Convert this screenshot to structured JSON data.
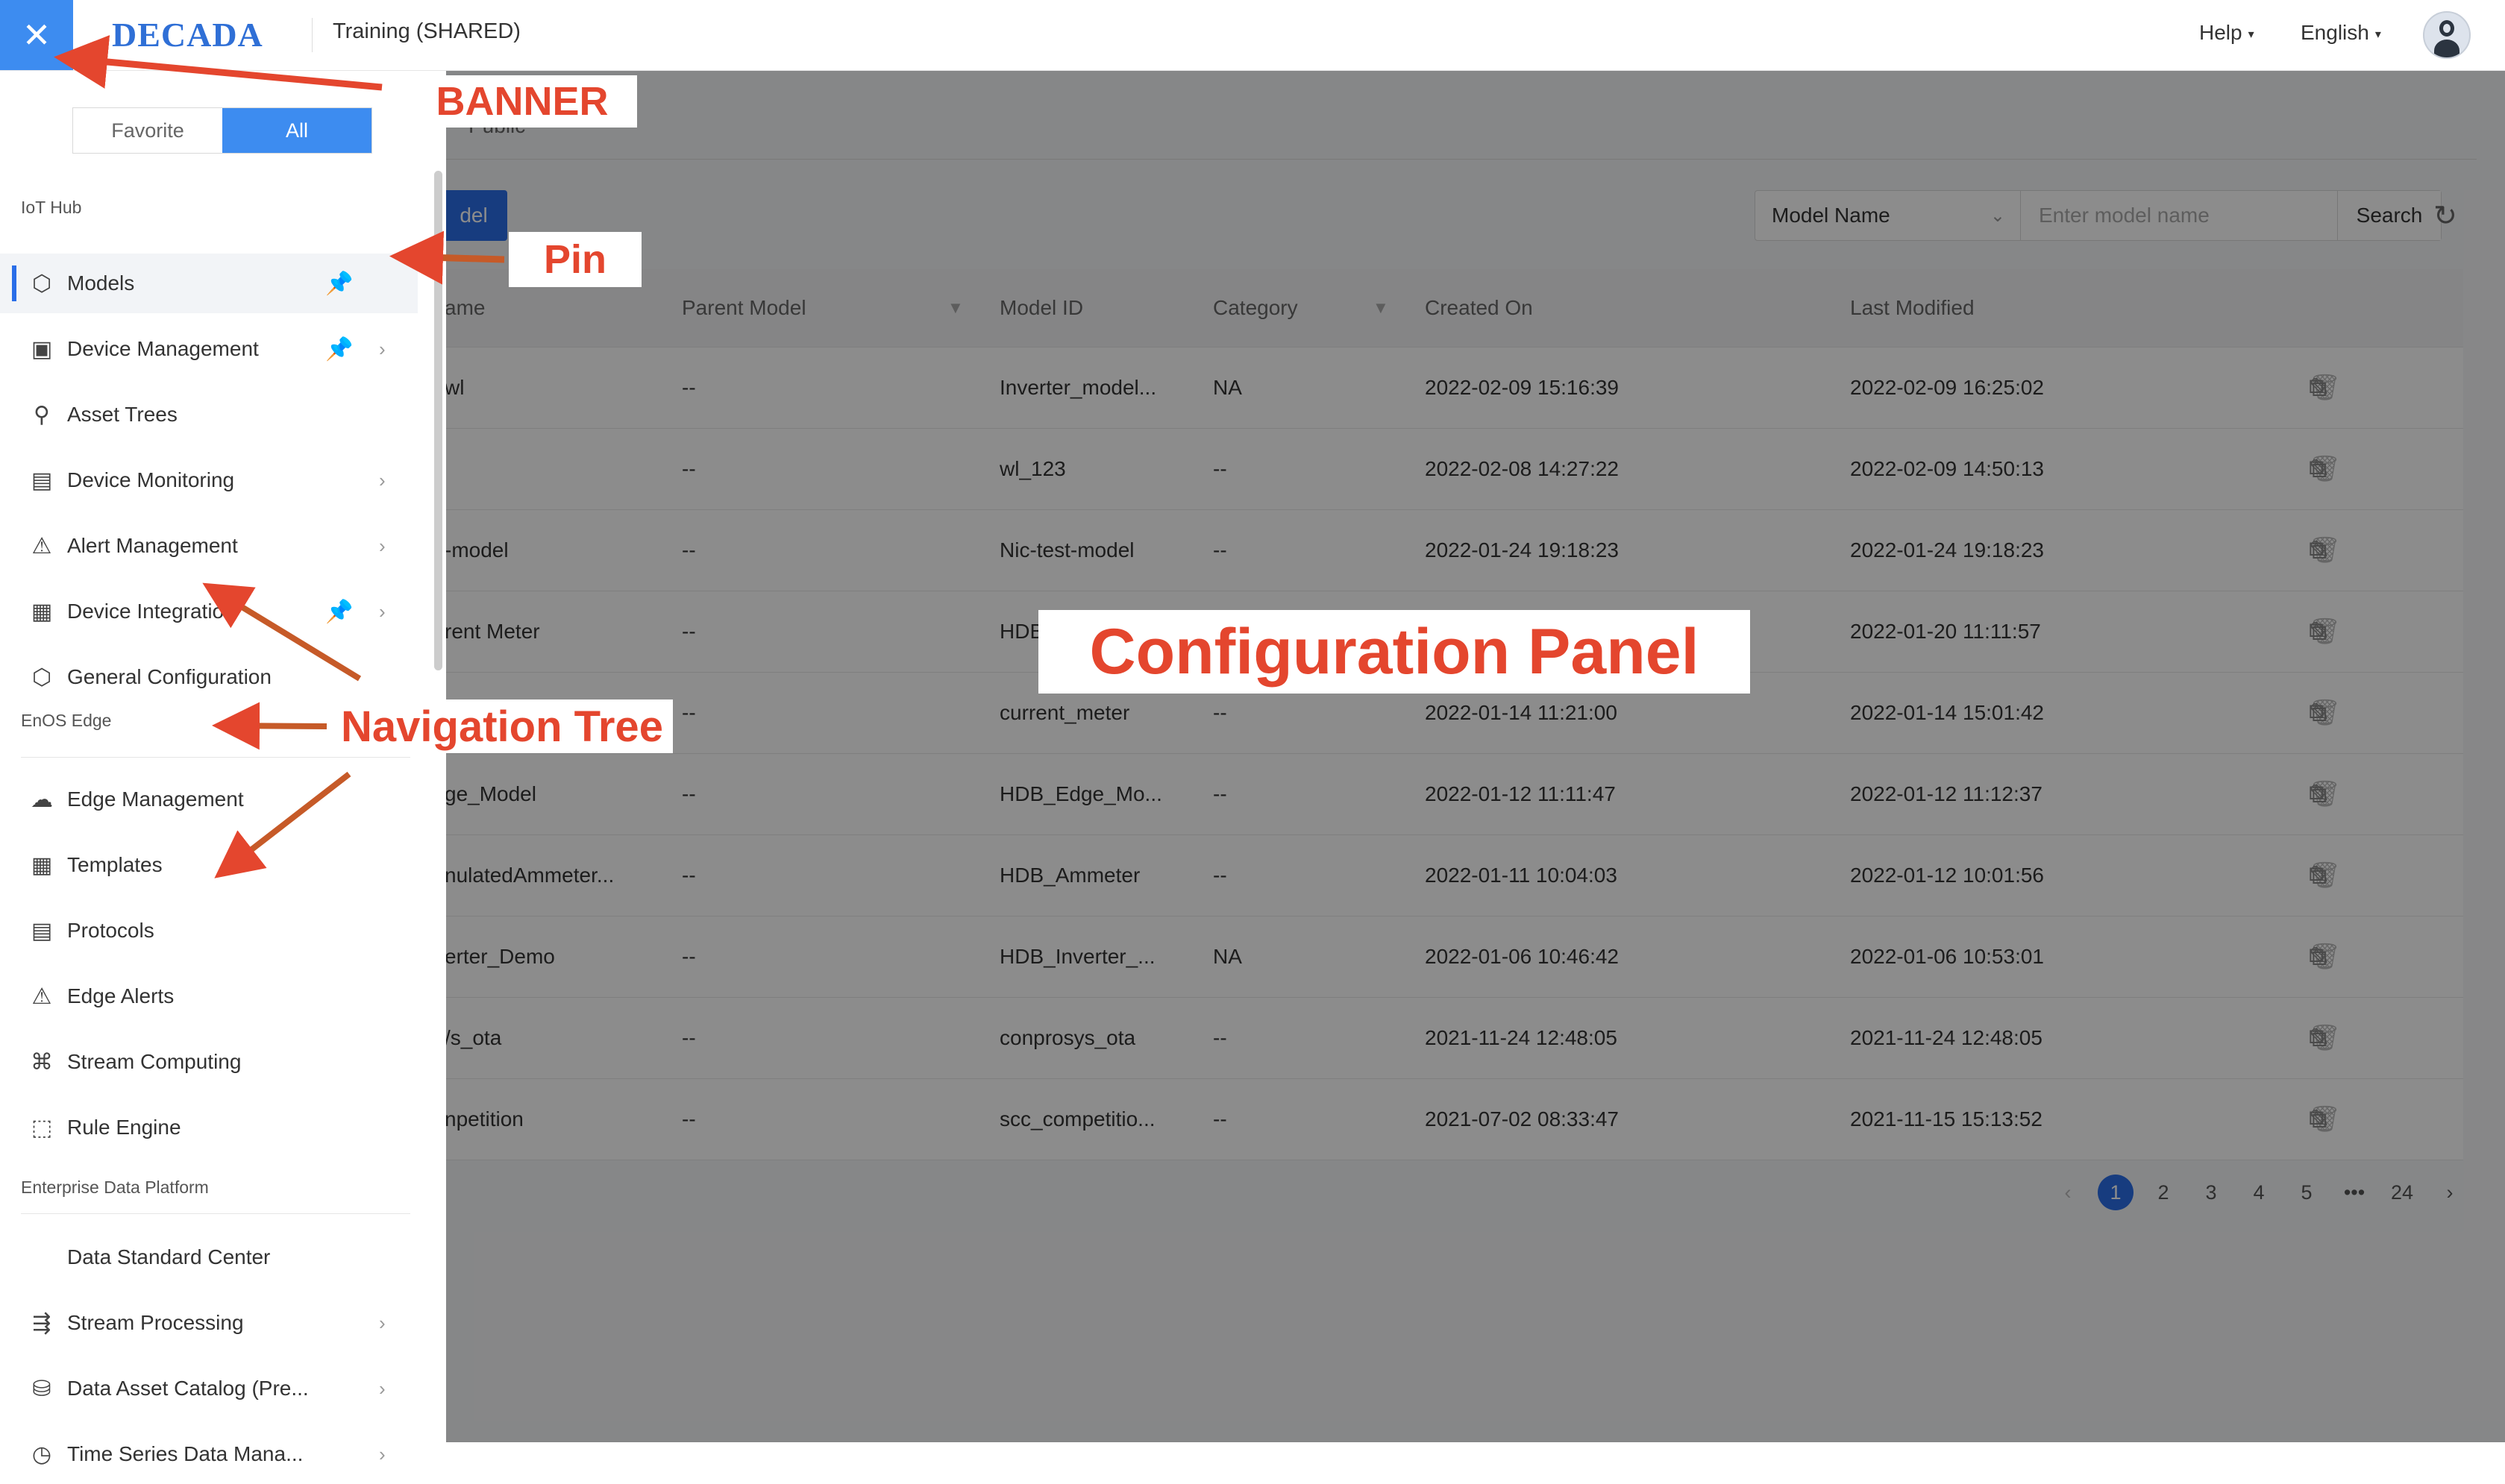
{
  "topbar": {
    "logo": "DECADA",
    "app_title": "Training (SHARED)",
    "help_label": "Help",
    "language_label": "English",
    "close_icon": "close-icon",
    "avatar_icon": "user-avatar-icon"
  },
  "sidebar": {
    "segment": {
      "favorite": "Favorite",
      "all": "All",
      "selected": "All"
    },
    "groups": [
      {
        "label": "IoT Hub",
        "items": [
          {
            "label": "Models",
            "icon": "cube-icon",
            "pinned": true,
            "chevron": false,
            "active": true
          },
          {
            "label": "Device Management",
            "icon": "device-icon",
            "pinned": true,
            "chevron": true
          },
          {
            "label": "Asset Trees",
            "icon": "tree-icon",
            "pinned": false,
            "chevron": false
          },
          {
            "label": "Device Monitoring",
            "icon": "monitor-icon",
            "pinned": false,
            "chevron": true
          },
          {
            "label": "Alert Management",
            "icon": "alert-icon",
            "pinned": false,
            "chevron": true
          },
          {
            "label": "Device Integration",
            "icon": "integration-icon",
            "pinned": true,
            "chevron": true
          },
          {
            "label": "General Configuration",
            "icon": "settings-icon",
            "pinned": false,
            "chevron": false
          }
        ]
      },
      {
        "label": "EnOS Edge",
        "items": [
          {
            "label": "Edge Management",
            "icon": "edge-icon",
            "pinned": false,
            "chevron": false
          },
          {
            "label": "Templates",
            "icon": "templates-icon",
            "pinned": false,
            "chevron": false
          },
          {
            "label": "Protocols",
            "icon": "protocols-icon",
            "pinned": false,
            "chevron": false
          },
          {
            "label": "Edge Alerts",
            "icon": "alert-icon",
            "pinned": false,
            "chevron": false
          },
          {
            "label": "Stream Computing",
            "icon": "stream-icon",
            "pinned": false,
            "chevron": false
          },
          {
            "label": "Rule Engine",
            "icon": "rule-icon",
            "pinned": false,
            "chevron": false
          }
        ]
      },
      {
        "label": "Enterprise Data Platform",
        "items": [
          {
            "label": "Data Standard Center",
            "icon": "",
            "pinned": false,
            "chevron": false
          },
          {
            "label": "Stream Processing",
            "icon": "stream-processing-icon",
            "pinned": false,
            "chevron": true
          },
          {
            "label": "Data Asset Catalog (Pre...",
            "icon": "catalog-icon",
            "pinned": false,
            "chevron": true
          },
          {
            "label": "Time Series Data Mana...",
            "icon": "timeseries-icon",
            "pinned": false,
            "chevron": true
          }
        ]
      }
    ]
  },
  "main": {
    "tab_public": "Public",
    "new_model_button": "del",
    "search": {
      "field_select": "Model Name",
      "placeholder": "Enter model name",
      "button": "Search"
    },
    "table": {
      "columns": [
        "ame",
        "Parent Model",
        "Model ID",
        "Category",
        "Created On",
        "Last Modified"
      ],
      "rows": [
        [
          "wl",
          "--",
          "Inverter_model...",
          "NA",
          "2022-02-09 15:16:39",
          "2022-02-09 16:25:02"
        ],
        [
          "",
          "--",
          "wl_123",
          "--",
          "2022-02-08 14:27:22",
          "2022-02-09 14:50:13"
        ],
        [
          "-model",
          "--",
          "Nic-test-model",
          "--",
          "2022-01-24 19:18:23",
          "2022-01-24 19:18:23"
        ],
        [
          "rent Meter",
          "--",
          "HDB",
          "",
          "",
          "2022-01-20 11:11:57"
        ],
        [
          "",
          "--",
          "current_meter",
          "--",
          "2022-01-14 11:21:00",
          "2022-01-14 15:01:42"
        ],
        [
          "ge_Model",
          "--",
          "HDB_Edge_Mo...",
          "--",
          "2022-01-12 11:11:47",
          "2022-01-12 11:12:37"
        ],
        [
          "nulatedAmmeter...",
          "--",
          "HDB_Ammeter",
          "--",
          "2022-01-11 10:04:03",
          "2022-01-12 10:01:56"
        ],
        [
          "erter_Demo",
          "--",
          "HDB_Inverter_...",
          "NA",
          "2022-01-06 10:46:42",
          "2022-01-06 10:53:01"
        ],
        [
          "/s_ota",
          "--",
          "conprosys_ota",
          "--",
          "2021-11-24 12:48:05",
          "2021-11-24 12:48:05"
        ],
        [
          "npetition",
          "--",
          "scc_competitio...",
          "--",
          "2021-07-02 08:33:47",
          "2021-11-15 15:13:52"
        ]
      ]
    },
    "pagination": {
      "pages": [
        "1",
        "2",
        "3",
        "4",
        "5",
        "•••",
        "24"
      ],
      "current": "1"
    }
  },
  "annotations": {
    "banner": "BANNER",
    "pin": "Pin",
    "config_panel": "Configuration Panel",
    "nav_tree": "Navigation Tree",
    "color": "#e4462e"
  }
}
